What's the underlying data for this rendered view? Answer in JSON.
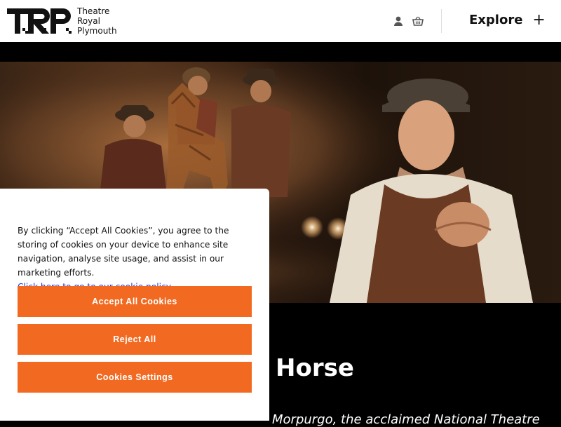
{
  "header": {
    "logo_lines": [
      "Theatre",
      "Royal",
      "Plymouth"
    ],
    "logo_letters": "TRP",
    "icons": {
      "account": "user-icon",
      "basket": "basket-icon"
    },
    "explore_label": "Explore",
    "explore_toggle": "+"
  },
  "hero": {
    "image_subject": "hero-image"
  },
  "show": {
    "title_fragment": "Horse",
    "description_fragment": "Morpurgo, the acclaimed National Theatre"
  },
  "cookie_banner": {
    "text": "By clicking “Accept All Cookies”, you agree to the storing of cookies on your device to enhance site navigation, analyse site usage, and assist in our marketing efforts.",
    "policy_link": "Click here to go to our cookie policy",
    "accept_label": "Accept All Cookies",
    "reject_label": "Reject All",
    "settings_label": "Cookies Settings"
  },
  "colors": {
    "accent": "#f26a21",
    "link": "#2233cc",
    "header_bg": "#ffffff",
    "page_bg": "#000000"
  }
}
